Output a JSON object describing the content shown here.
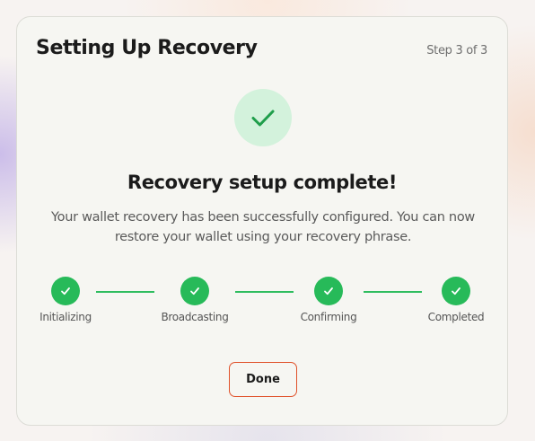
{
  "header": {
    "title": "Setting Up Recovery",
    "step_indicator": "Step 3 of 3"
  },
  "status": {
    "icon": "checkmark-icon",
    "heading": "Recovery setup complete!",
    "description": "Your wallet recovery has been successfully configured. You can now restore your wallet using your recovery phrase."
  },
  "progress": {
    "steps": [
      {
        "label": "Initializing",
        "state": "complete",
        "icon": "checkmark-icon"
      },
      {
        "label": "Broadcasting",
        "state": "complete",
        "icon": "checkmark-icon"
      },
      {
        "label": "Confirming",
        "state": "complete",
        "icon": "checkmark-icon"
      },
      {
        "label": "Completed",
        "state": "complete",
        "icon": "checkmark-icon"
      }
    ]
  },
  "actions": {
    "done_label": "Done"
  },
  "colors": {
    "success_green": "#27ba59",
    "success_bg": "#d3f2dc",
    "accent_border": "#e0512a",
    "card_bg": "#f6f6f2"
  }
}
